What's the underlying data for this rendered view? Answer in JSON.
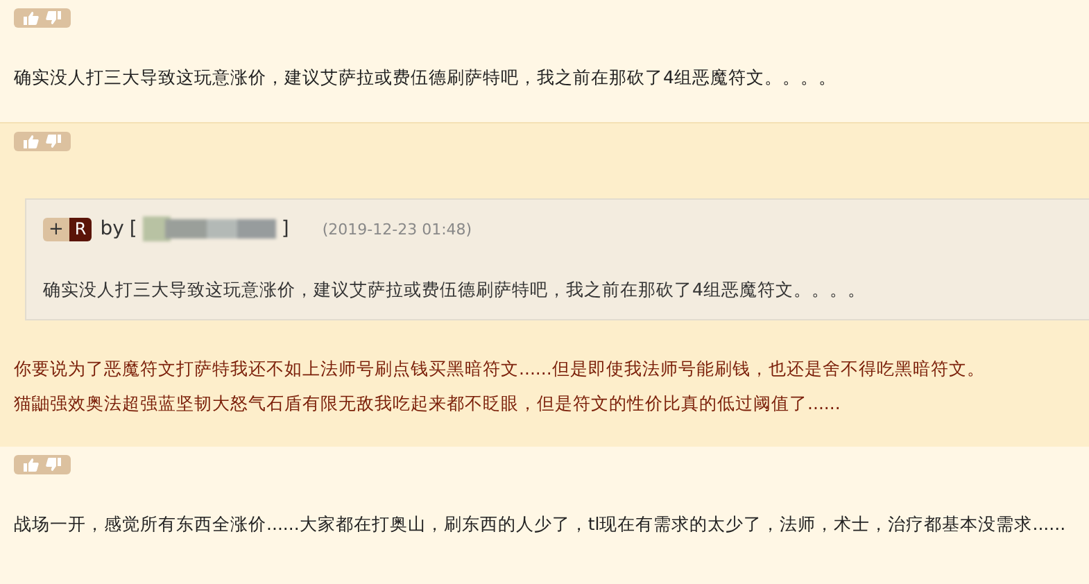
{
  "posts": [
    {
      "highlighted": false,
      "color": "#222222",
      "lines": [
        "确实没人打三大导致这玩意涨价，建议艾萨拉或费伍德刷萨特吧，我之前在那砍了4组恶魔符文。。。。"
      ]
    },
    {
      "highlighted": true,
      "color": "#7a1e08",
      "quote": {
        "plus": "+",
        "badge": "R",
        "by": "by",
        "open": "[",
        "close": "]",
        "time": "(2019-12-23 01:48)",
        "text": "确实没人打三大导致这玩意涨价，建议艾萨拉或费伍德刷萨特吧，我之前在那砍了4组恶魔符文。。。。"
      },
      "lines": [
        "你要说为了恶魔符文打萨特我还不如上法师号刷点钱买黑暗符文......但是即使我法师号能刷钱，也还是舍不得吃黑暗符文。",
        "猫鼬强效奥法超强蓝坚韧大怒气石盾有限无敌我吃起来都不眨眼，但是符文的性价比真的低过阈值了......"
      ]
    },
    {
      "highlighted": false,
      "color": "#222222",
      "lines": [
        "战场一开，感觉所有东西全涨价......大家都在打奥山，刷东西的人少了，tl现在有需求的太少了，法师，术士，治疗都基本没需求......"
      ]
    }
  ]
}
